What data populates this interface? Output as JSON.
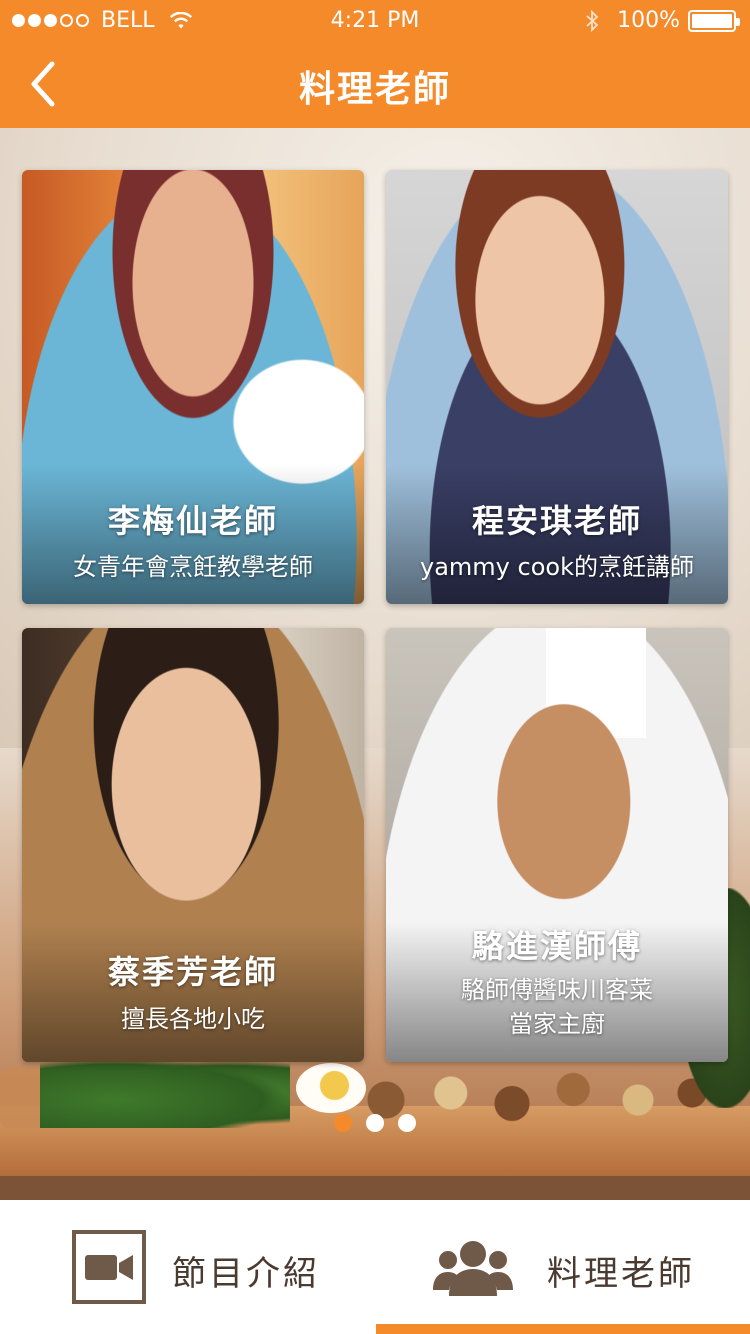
{
  "status_bar": {
    "carrier": "BELL",
    "time": "4:21 PM",
    "battery": "100%",
    "signal_level": 3,
    "signal_max": 5
  },
  "nav": {
    "title": "料理老師",
    "back_icon": "chevron-left-icon"
  },
  "teachers": [
    {
      "name": "李梅仙老師",
      "desc_lines": [
        "女青年會烹飪教學老師"
      ]
    },
    {
      "name": "程安琪老師",
      "desc_lines": [
        "yammy cook的烹飪講師"
      ]
    },
    {
      "name": "蔡季芳老師",
      "desc_lines": [
        "擅長各地小吃"
      ]
    },
    {
      "name": "駱進漢師傅",
      "desc_lines": [
        "駱師傅醬味川客菜",
        "當家主廚"
      ]
    }
  ],
  "pager": {
    "count": 3,
    "active_index": 0
  },
  "tabbar": {
    "tabs": [
      {
        "label": "節目介紹",
        "icon": "video-camera-icon"
      },
      {
        "label": "料理老師",
        "icon": "people-group-icon"
      }
    ],
    "active_index": 1
  },
  "colors": {
    "accent": "#f58a2a",
    "tab_text": "#4a3a30"
  }
}
